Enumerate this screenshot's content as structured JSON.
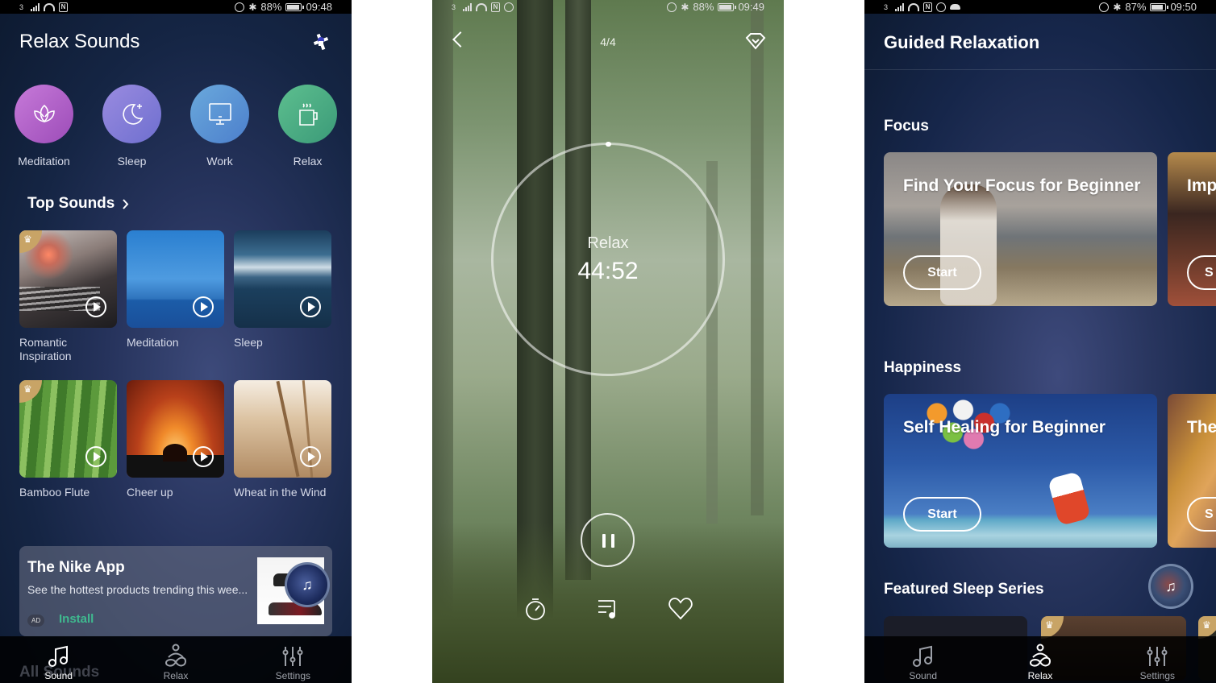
{
  "screens": [
    {
      "status": {
        "sim": "3",
        "battery": "88%",
        "time": "09:48"
      },
      "header": {
        "title": "Relax Sounds",
        "action_icon": "ad-windmill-icon"
      },
      "categories": [
        {
          "label": "Meditation",
          "icon": "lotus-icon",
          "color_from": "#c77ad9",
          "color_to": "#9c4cb8"
        },
        {
          "label": "Sleep",
          "icon": "moon-icon",
          "color_from": "#9a8be0",
          "color_to": "#6e6fcf"
        },
        {
          "label": "Work",
          "icon": "monitor-icon",
          "color_from": "#6aa9dc",
          "color_to": "#4c7fcc"
        },
        {
          "label": "Relax",
          "icon": "cup-icon",
          "color_from": "#5dbf8f",
          "color_to": "#3b9a78"
        }
      ],
      "top_sounds": {
        "title": "Top Sounds",
        "items": [
          {
            "label": "Romantic Inspiration",
            "premium": true,
            "thumb": "piano"
          },
          {
            "label": "Meditation",
            "premium": false,
            "thumb": "sea"
          },
          {
            "label": "Sleep",
            "premium": false,
            "thumb": "storm-sea"
          },
          {
            "label": "Bamboo Flute",
            "premium": true,
            "thumb": "bamboo"
          },
          {
            "label": "Cheer up",
            "premium": false,
            "thumb": "concert"
          },
          {
            "label": "Wheat in the Wind",
            "premium": false,
            "thumb": "wheat"
          }
        ]
      },
      "ad": {
        "title": "The Nike App",
        "description": "See the hottest products trending this wee...",
        "badge": "AD",
        "cta": "Install",
        "cta_color": "#3fb98f"
      },
      "ghost_section": "All Sounds",
      "tabs": [
        {
          "label": "Sound",
          "icon": "music-note-icon",
          "active": true
        },
        {
          "label": "Relax",
          "icon": "meditating-person-icon",
          "active": false
        },
        {
          "label": "Settings",
          "icon": "sliders-icon",
          "active": false
        }
      ]
    },
    {
      "status": {
        "sim": "3",
        "battery": "88%",
        "time": "09:49"
      },
      "header": {
        "page_count": "4/4"
      },
      "player": {
        "mode": "Relax",
        "remaining": "44:52",
        "state": "playing"
      },
      "controls": [
        {
          "name": "timer",
          "icon": "stopwatch-icon"
        },
        {
          "name": "playlist",
          "icon": "playlist-icon"
        },
        {
          "name": "favorite",
          "icon": "heart-icon"
        }
      ]
    },
    {
      "status": {
        "sim": "3",
        "battery": "87%",
        "time": "09:50"
      },
      "header": {
        "title": "Guided Relaxation"
      },
      "sections": [
        {
          "title": "Focus",
          "cards": [
            {
              "title": "Find Your Focus for Beginner",
              "button": "Start"
            },
            {
              "title": "Imp",
              "button": "S"
            }
          ]
        },
        {
          "title": "Happiness",
          "cards": [
            {
              "title": "Self Healing for Beginner",
              "button": "Start"
            },
            {
              "title": "The",
              "button": "S"
            }
          ]
        },
        {
          "title": "Featured Sleep Series",
          "cards": []
        }
      ],
      "tabs": [
        {
          "label": "Sound",
          "icon": "music-note-icon",
          "active": false
        },
        {
          "label": "Relax",
          "icon": "meditating-person-icon",
          "active": true
        },
        {
          "label": "Settings",
          "icon": "sliders-icon",
          "active": false
        }
      ]
    }
  ]
}
